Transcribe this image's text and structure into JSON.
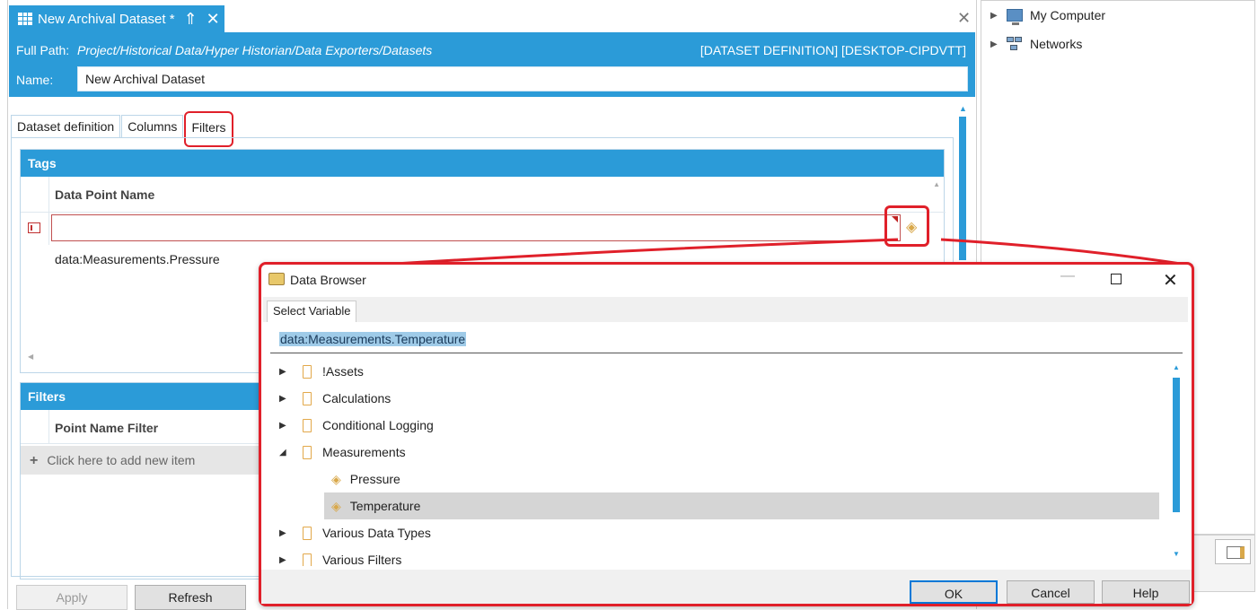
{
  "document": {
    "tab_title": "New Archival Dataset *",
    "full_path_label": "Full Path:",
    "full_path_value": "Project/Historical Data/Hyper Historian/Data Exporters/Datasets",
    "dataset_info": "[DATASET DEFINITION] [DESKTOP-CIPDVTT]",
    "name_label": "Name:",
    "name_value": "New Archival Dataset",
    "tabs": [
      {
        "label": "Dataset definition",
        "active": false
      },
      {
        "label": "Columns",
        "active": false
      },
      {
        "label": "Filters",
        "active": true
      }
    ],
    "tags_section": {
      "title": "Tags",
      "column_header": "Data Point Name",
      "rows": [
        "data:Measurements.Pressure"
      ]
    },
    "filters_section": {
      "title": "Filters",
      "column_header": "Point Name Filter",
      "add_item": "Click here to add new item"
    },
    "apply_label": "Apply",
    "refresh_label": "Refresh"
  },
  "right_panel": {
    "nodes": [
      {
        "label": "My Computer",
        "icon": "computer-icon"
      },
      {
        "label": "Networks",
        "icon": "network-icon"
      }
    ]
  },
  "dialog": {
    "title": "Data Browser",
    "tab_label": "Select Variable",
    "selected_value": "data:Measurements.Temperature",
    "tree": [
      {
        "label": "!Assets",
        "type": "folder",
        "expanded": false,
        "level": 0
      },
      {
        "label": "Calculations",
        "type": "folder",
        "expanded": false,
        "level": 0
      },
      {
        "label": "Conditional Logging",
        "type": "folder",
        "expanded": false,
        "level": 0
      },
      {
        "label": "Measurements",
        "type": "folder",
        "expanded": true,
        "level": 0
      },
      {
        "label": "Pressure",
        "type": "tag",
        "level": 1
      },
      {
        "label": "Temperature",
        "type": "tag",
        "level": 1,
        "selected": true
      },
      {
        "label": "Various Data Types",
        "type": "folder",
        "expanded": false,
        "level": 0
      },
      {
        "label": "Various Filters",
        "type": "folder",
        "expanded": false,
        "level": 0
      }
    ],
    "ok_label": "OK",
    "cancel_label": "Cancel",
    "help_label": "Help"
  },
  "colors": {
    "accent": "#2b9bd8",
    "highlight_red": "#e0202a",
    "selection_bg": "#9fcbe8"
  }
}
